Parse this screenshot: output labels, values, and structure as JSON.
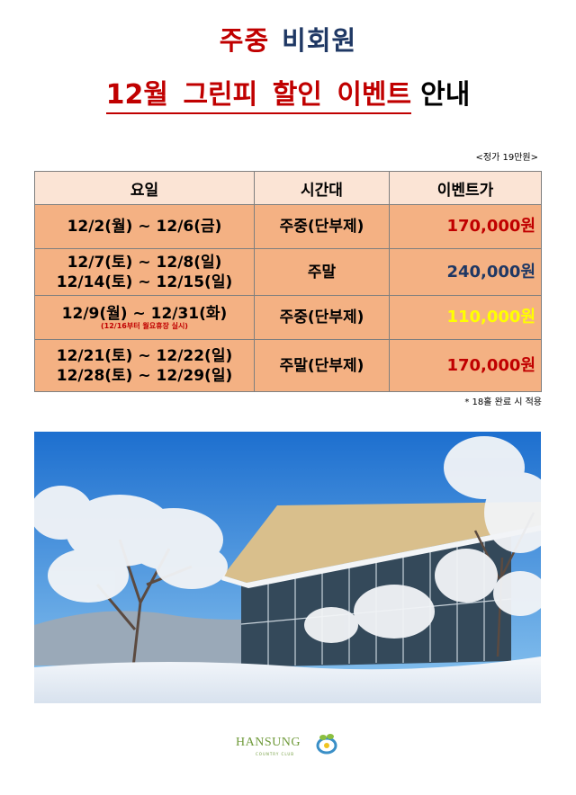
{
  "header": {
    "title_red": "주중",
    "title_navy": "비회원",
    "event_line": "12월 그린피 할인 이벤트",
    "event_tail": "안내"
  },
  "price_note": "<정가 19만원>",
  "table": {
    "headers": [
      "요일",
      "시간대",
      "이벤트가"
    ],
    "rows": [
      {
        "day1": "12/2(월) ~ 12/6(금)",
        "day2": "",
        "note": "",
        "time": "주중(단부제)",
        "price": "170,000원",
        "price_color": "#c00000"
      },
      {
        "day1": "12/7(토) ~ 12/8(일)",
        "day2": "12/14(토) ~ 12/15(일)",
        "note": "",
        "time": "주말",
        "price": "240,000원",
        "price_color": "#1f3864"
      },
      {
        "day1": "12/9(월) ~ 12/31(화)",
        "day2": "",
        "note": "(12/16부터 월요휴장 실시)",
        "time": "주중(단부제)",
        "price": "110,000원",
        "price_color": "#ffff00"
      },
      {
        "day1": "12/21(토) ~ 12/22(일)",
        "day2": "12/28(토) ~ 12/29(일)",
        "note": "",
        "time": "주말(단부제)",
        "price": "170,000원",
        "price_color": "#c00000"
      }
    ]
  },
  "foot_note": "* 18홀 완료 시 적용",
  "logo": {
    "brand": "HANSUNG",
    "sub": "COUNTRY CLUB"
  }
}
